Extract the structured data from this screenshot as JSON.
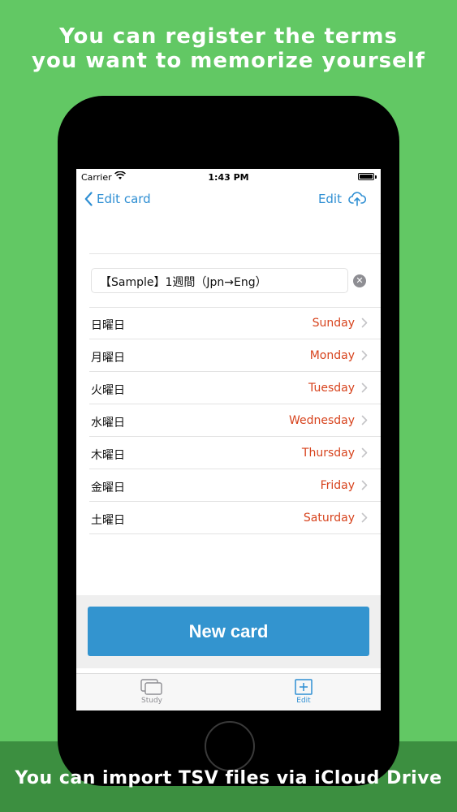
{
  "promo": {
    "headline_line1": "You can register the terms",
    "headline_line2": "you want to memorize yourself",
    "footer": "You can import TSV files via iCloud Drive"
  },
  "statusbar": {
    "carrier": "Carrier",
    "time": "1:43 PM"
  },
  "navbar": {
    "back_label": "Edit card",
    "edit_label": "Edit"
  },
  "card_title": "【Sample】1週間（Jpn→Eng）",
  "rows": [
    {
      "term": "日曜日",
      "meaning": "Sunday"
    },
    {
      "term": "月曜日",
      "meaning": "Monday"
    },
    {
      "term": "火曜日",
      "meaning": "Tuesday"
    },
    {
      "term": "水曜日",
      "meaning": "Wednesday"
    },
    {
      "term": "木曜日",
      "meaning": "Thursday"
    },
    {
      "term": "金曜日",
      "meaning": "Friday"
    },
    {
      "term": "土曜日",
      "meaning": "Saturday"
    }
  ],
  "new_card_label": "New card",
  "tabs": {
    "study": "Study",
    "edit": "Edit"
  },
  "colors": {
    "accent": "#2f8fd3",
    "meaning_text": "#d7431d",
    "background": "#62c864",
    "button": "#3394cf"
  }
}
